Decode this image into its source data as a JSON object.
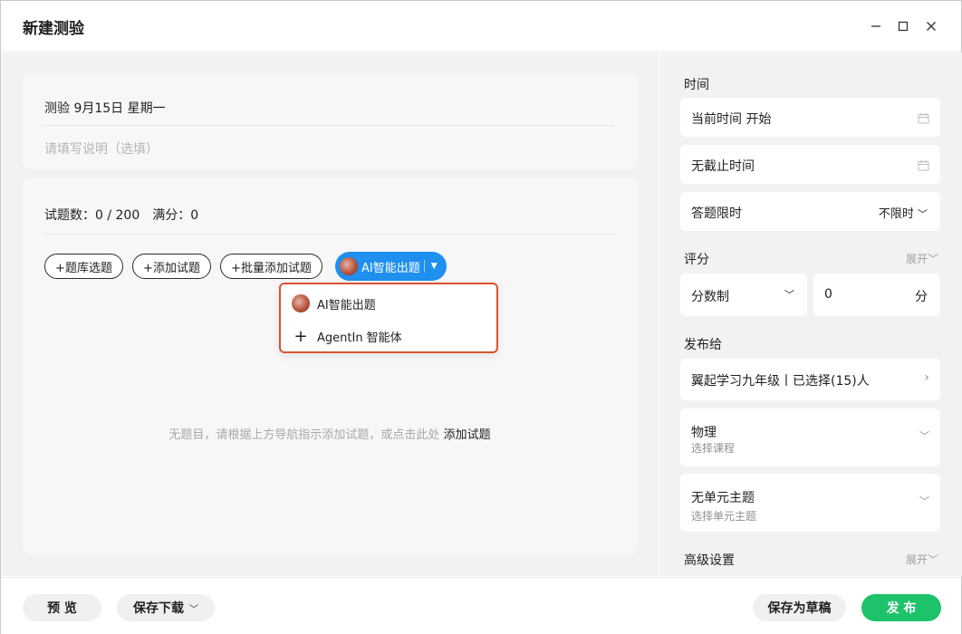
{
  "window": {
    "title": "新建测验",
    "controls": [
      "minimize-icon",
      "maximize-icon",
      "close-icon"
    ]
  },
  "quiz": {
    "title": "测验 9月15日 星期一",
    "description_placeholder": "请填写说明（选填）"
  },
  "questions": {
    "count_label": "试题数：",
    "count_value": "0 / 200",
    "score_label": "满分：",
    "score_value": "0",
    "buttons": {
      "bank": "+题库选题",
      "add": "+添加试题",
      "batch": "+批量添加试题",
      "ai": "AI智能出题"
    },
    "empty_tip": "无题目，请根据上方导航指示添加试题，或点击此处",
    "empty_link": "添加试题"
  },
  "ai_menu": {
    "items": [
      {
        "label": "AI智能出题",
        "icon": "ai-avatar-icon"
      },
      {
        "label": "AgentIn 智能体",
        "icon": "plus-icon"
      }
    ],
    "border_color": "#d9542f"
  },
  "sidebar": {
    "time_label": "时间",
    "start_time": "当前时间 开始",
    "end_time": "无截止时间",
    "limit_label": "答题限时",
    "limit_value": "不限时",
    "scoring_label": "评分",
    "scoring_expand": "展开",
    "score_mode": "分数制",
    "score_input": "0",
    "score_unit": "分",
    "publish_label": "发布给",
    "publish_target": "翼起学习九年级丨已选择(15)人",
    "subject": "物理",
    "subject_sub": "选择课程",
    "unit": "无单元主题",
    "unit_sub": "选择单元主题",
    "advanced_label": "高级设置",
    "advanced_expand": "展开"
  },
  "footer": {
    "preview": "预 览",
    "save_download": "保存下载",
    "save_draft": "保存为草稿",
    "publish": "发 布"
  },
  "colors": {
    "accent_blue": "#1f8ff0",
    "publish_green": "#1dc26a",
    "panel_bg": "#f2f2f3"
  }
}
